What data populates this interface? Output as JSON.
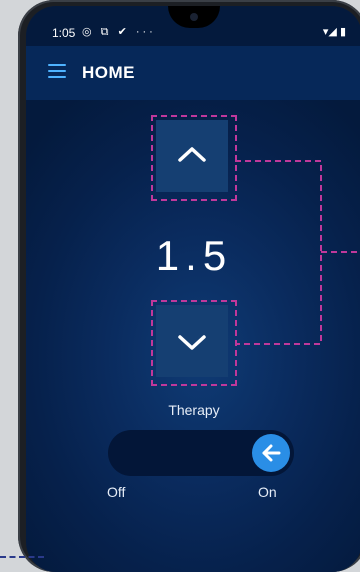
{
  "status_bar": {
    "time": "1:05",
    "left_icons": "◎ ⧉ ✔ ···",
    "right_icons": "▾◢ ▮"
  },
  "appbar": {
    "title": "HOME"
  },
  "setting": {
    "value": "1.5",
    "mode_label": "Therapy"
  },
  "toggle": {
    "off_label": "Off",
    "on_label": "On",
    "state": "on"
  },
  "icons": {
    "menu": "hamburger-menu-icon",
    "increase": "chevron-up-icon",
    "decrease": "chevron-down-icon",
    "toggle_knob": "arrow-left-icon"
  },
  "colors": {
    "accent": "#2a8ee6",
    "highlight_dashes": "#c0389b",
    "background": "#06214c"
  }
}
